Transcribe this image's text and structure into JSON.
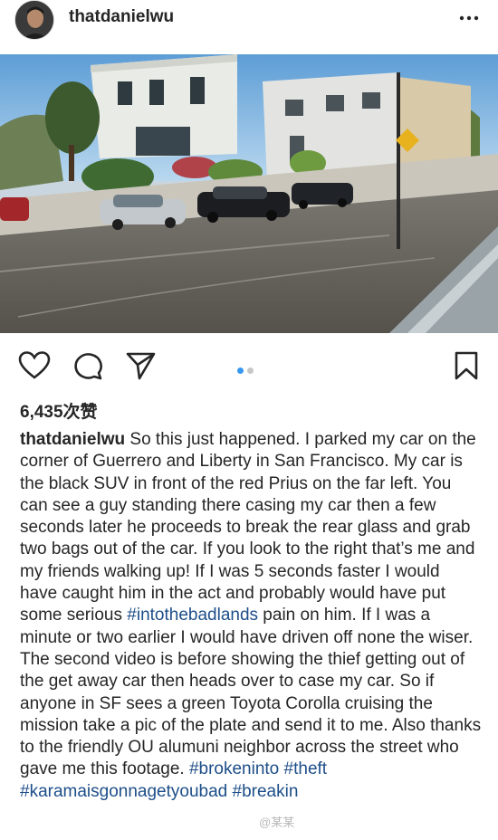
{
  "post": {
    "username": "thatdanielwu",
    "likes": "6,435次赞"
  },
  "header": {
    "more_icon": "three-dots-icon"
  },
  "actions": {
    "icons": [
      "heart-icon",
      "comment-icon",
      "share-icon",
      "bookmark-icon"
    ],
    "carousel_active": 1,
    "carousel_total": 2
  },
  "caption": {
    "username": "thatdanielwu",
    "text1": " So this just happened. I parked my car on the corner of Guerrero and Liberty in San Francisco. My car is the black SUV in front of the red Prius on the far left. You can see a guy standing there casing my car then a few seconds later he proceeds to break the rear glass and grab two bags out of the car. If you look to the right that’s me and my friends walking up! If I was 5 seconds faster I would have caught him in the act and probably would have put some serious ",
    "hashtag1": "#intothebadlands",
    "text2": " pain on him. If I was a minute or two earlier I would have driven off none the wiser. The second video is before showing the thief getting out of the get away car then heads over to case my car. So if anyone in SF sees a green Toyota Corolla cruising the mission take a pic of the plate and send it to me. Also thanks to the friendly OU alumuni neighbor across the street who gave me this footage. ",
    "hashtag2": "#brokeninto",
    "hashtag3": "#theft",
    "hashtag4": "#karamaisgonnagetyoubad",
    "hashtag5": "#breakin"
  },
  "watermark": "@某某",
  "colors": {
    "hashtag": "#1d4e89",
    "text": "#262626",
    "carousel_active": "#3897f0",
    "carousel_inactive": "#c7c7c7"
  }
}
